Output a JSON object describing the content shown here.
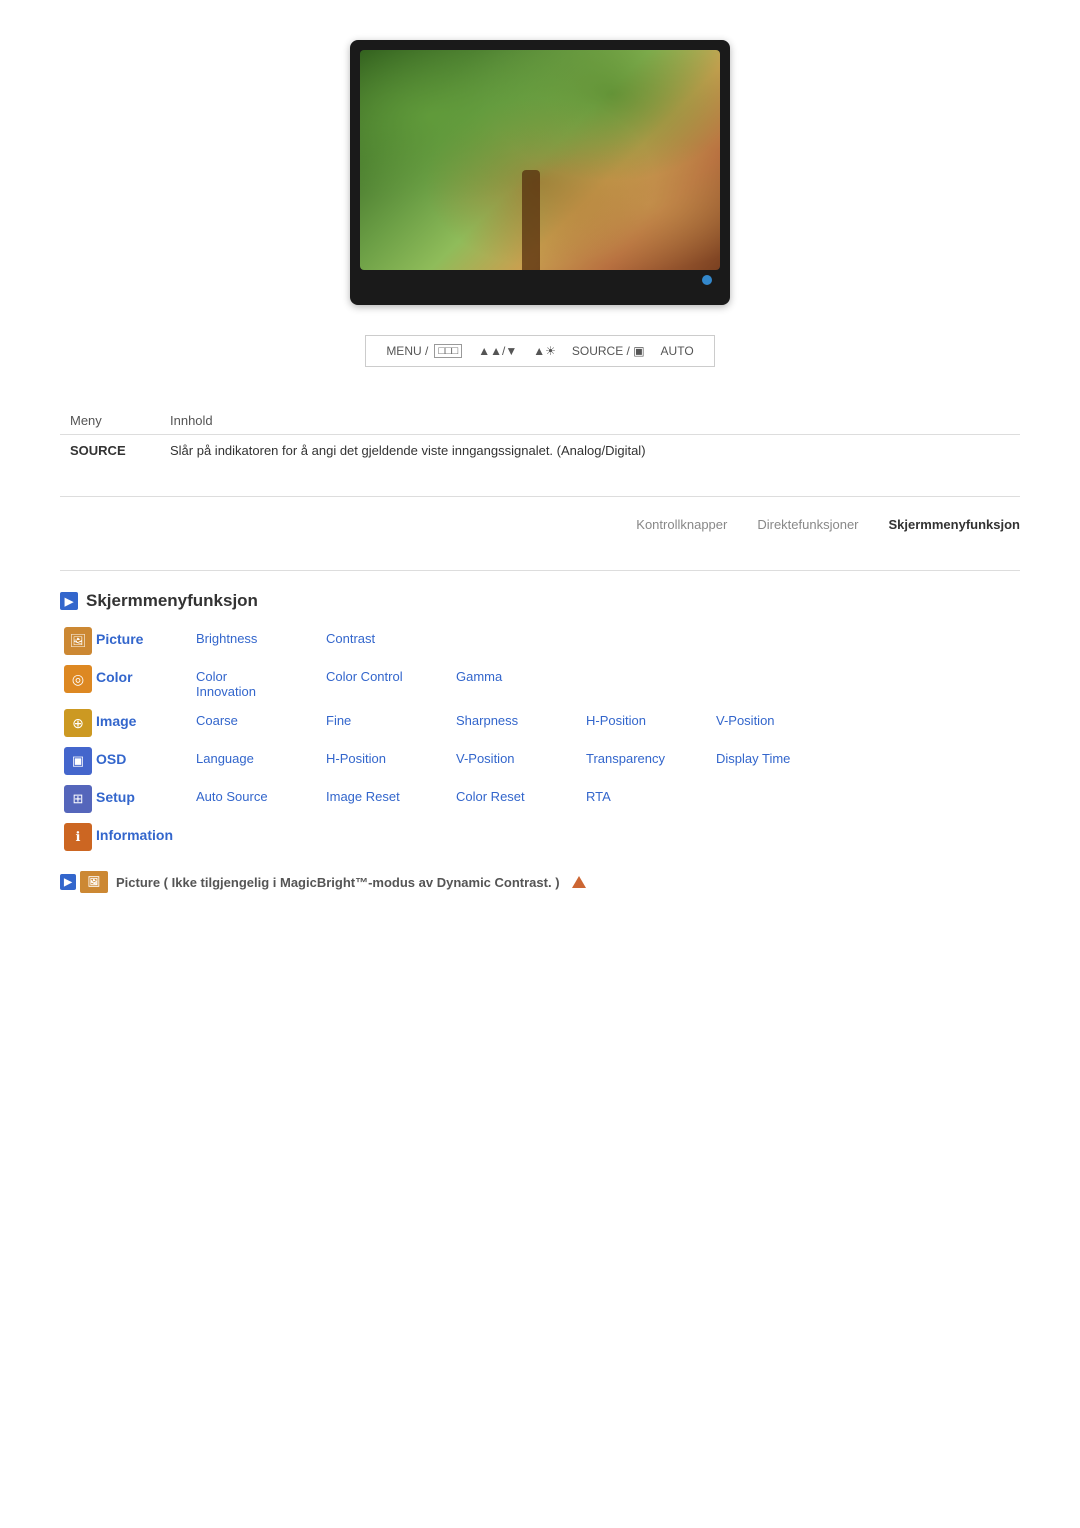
{
  "monitor": {
    "led_color": "#3388cc"
  },
  "control_bar": {
    "items": [
      "MENU / □□□",
      "▲▲/▼",
      "▲☀",
      "SOURCE / ▣",
      "AUTO"
    ]
  },
  "table": {
    "headers": [
      "Meny",
      "Innhold"
    ],
    "rows": [
      {
        "label": "SOURCE",
        "content": "Slår på indikatoren for å angi det gjeldende viste inngangssignalet. (Analog/Digital)"
      }
    ]
  },
  "nav_tabs": [
    {
      "label": "Kontrollknapper",
      "active": false
    },
    {
      "label": "Direktefunksjoner",
      "active": false
    },
    {
      "label": "Skjermmenyfunksjon",
      "active": true
    }
  ],
  "section": {
    "title": "Skjermmenyfunksjon",
    "icon_label": "▶"
  },
  "menu_items": [
    {
      "icon_type": "picture",
      "icon_symbol": "🖼",
      "main_label": "Picture",
      "sub_labels": [
        "Brightness",
        "Contrast",
        "",
        "",
        ""
      ]
    },
    {
      "icon_type": "color",
      "icon_symbol": "◎",
      "main_label": "Color",
      "sub_labels": [
        "Color\nInnovation",
        "Color Control",
        "Gamma",
        "",
        ""
      ]
    },
    {
      "icon_type": "image",
      "icon_symbol": "⊕",
      "main_label": "Image",
      "sub_labels": [
        "Coarse",
        "Fine",
        "Sharpness",
        "H-Position",
        "V-Position"
      ]
    },
    {
      "icon_type": "osd",
      "icon_symbol": "▣",
      "main_label": "OSD",
      "sub_labels": [
        "Language",
        "H-Position",
        "V-Position",
        "Transparency",
        "Display Time"
      ]
    },
    {
      "icon_type": "setup",
      "icon_symbol": "⊞",
      "main_label": "Setup",
      "sub_labels": [
        "Auto Source",
        "Image Reset",
        "Color Reset",
        "RTA",
        ""
      ]
    },
    {
      "icon_type": "information",
      "icon_symbol": "ℹ",
      "main_label": "Information",
      "sub_labels": [
        "",
        "",
        "",
        "",
        ""
      ]
    }
  ],
  "bottom_note": {
    "text": "Picture ( Ikke tilgjengelig i MagicBright™-modus av Dynamic Contrast. )"
  },
  "labels": {
    "brightness": "Brightness",
    "contrast": "Contrast",
    "color_innovation": "Color Innovation",
    "color_control": "Color Control",
    "gamma": "Gamma",
    "coarse": "Coarse",
    "fine": "Fine",
    "sharpness": "Sharpness",
    "h_position": "H-Position",
    "v_position": "V-Position",
    "language": "Language",
    "v_position2": "V-Position",
    "transparency": "Transparency",
    "display_time": "Display Time",
    "auto_source": "Auto Source",
    "image_reset": "Image Reset",
    "color_reset": "Color Reset",
    "rta": "RTA"
  }
}
